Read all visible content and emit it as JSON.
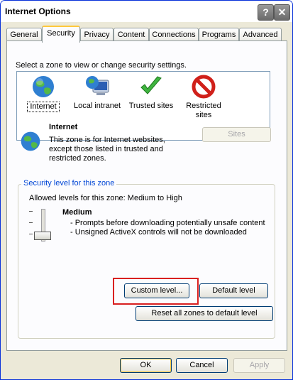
{
  "window": {
    "title": "Internet Options",
    "help_glyph": "?",
    "close_glyph": "✕"
  },
  "tabs": [
    {
      "label": "General"
    },
    {
      "label": "Security"
    },
    {
      "label": "Privacy"
    },
    {
      "label": "Content"
    },
    {
      "label": "Connections"
    },
    {
      "label": "Programs"
    },
    {
      "label": "Advanced"
    }
  ],
  "zones": {
    "prompt": "Select a zone to view or change security settings.",
    "items": [
      {
        "label": "Internet",
        "icon": "globe-icon"
      },
      {
        "label": "Local intranet",
        "icon": "monitor-globe-icon"
      },
      {
        "label": "Trusted sites",
        "icon": "checkmark-icon"
      },
      {
        "label": "Restricted sites",
        "icon": "restricted-icon"
      }
    ],
    "selected": "Internet"
  },
  "zone_info": {
    "title": "Internet",
    "description": "This zone is for Internet websites, except those listed in trusted and restricted zones.",
    "sites_button": "Sites"
  },
  "security_level": {
    "group_title": "Security level for this zone",
    "allowed": "Allowed levels for this zone: Medium to High",
    "level_name": "Medium",
    "bullets": [
      "- Prompts before downloading potentially unsafe content",
      "- Unsigned ActiveX controls will not be downloaded"
    ],
    "custom_button": "Custom level...",
    "default_button": "Default level",
    "reset_button": "Reset all zones to default level"
  },
  "footer": {
    "ok": "OK",
    "cancel": "Cancel",
    "apply": "Apply"
  },
  "colors": {
    "accent": "#0046d5",
    "highlight": "#d92020",
    "tab_active": "#ffc83c",
    "title_bar": "#ffffff"
  }
}
